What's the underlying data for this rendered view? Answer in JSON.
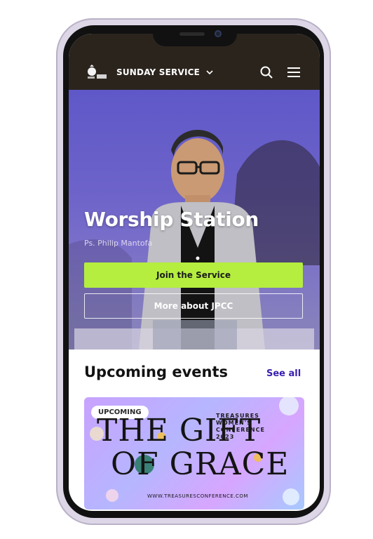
{
  "nav": {
    "section_label": "SUNDAY SERVICE"
  },
  "hero": {
    "title": "Worship Station",
    "subtitle": "Ps. Philip Mantofa",
    "join_label": "Join the Service",
    "more_label": "More about JPCC"
  },
  "events": {
    "heading": "Upcoming events",
    "see_all_label": "See all",
    "card": {
      "badge": "UPCOMING",
      "title_line1": "THE GIFT",
      "title_line2": "OF GRACE",
      "organizer_lines": [
        "TREASURES",
        "WOMEN'S",
        "CONFERENCE",
        "2023"
      ],
      "url": "WWW.TREASURESCONFERENCE.COM"
    }
  },
  "colors": {
    "nav_bg": "#2b241d",
    "accent_green": "#b5ee3f",
    "link_purple": "#3a1fb0"
  },
  "icons": [
    "logo-icon",
    "chevron-down-icon",
    "search-icon",
    "menu-icon"
  ]
}
